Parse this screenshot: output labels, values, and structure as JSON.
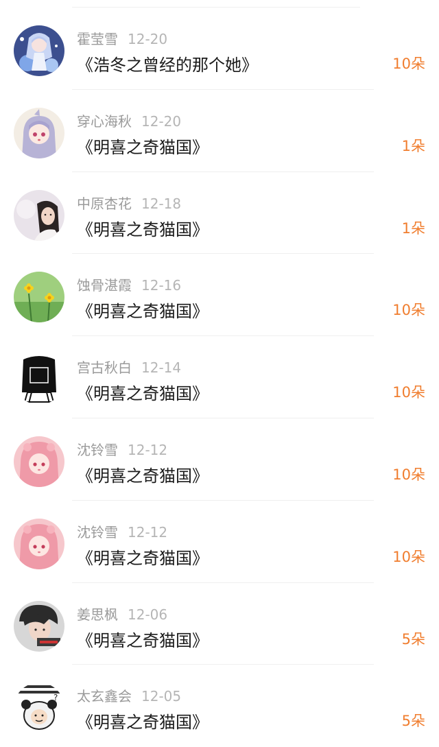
{
  "gift_records": [
    {
      "name": "霍莹雪",
      "date": "12-20",
      "title": "《浩冬之曾经的那个她》",
      "count": "10朵",
      "avatar_icon": "anime-girl-blue-avatar"
    },
    {
      "name": "穿心海秋",
      "date": "12-20",
      "title": "《明喜之奇猫国》",
      "count": "1朵",
      "avatar_icon": "anime-girl-lilac-hair-avatar"
    },
    {
      "name": "中原杏花",
      "date": "12-18",
      "title": "《明喜之奇猫国》",
      "count": "1朵",
      "avatar_icon": "girl-photo-avatar"
    },
    {
      "name": "蚀骨湛霞",
      "date": "12-16",
      "title": "《明喜之奇猫国》",
      "count": "10朵",
      "avatar_icon": "yellow-flowers-avatar"
    },
    {
      "name": "宫古秋白",
      "date": "12-14",
      "title": "《明喜之奇猫国》",
      "count": "10朵",
      "avatar_icon": "black-silhouette-girl-avatar"
    },
    {
      "name": "沈铃雪",
      "date": "12-12",
      "title": "《明喜之奇猫国》",
      "count": "10朵",
      "avatar_icon": "anime-girl-pink-avatar"
    },
    {
      "name": "沈铃雪",
      "date": "12-12",
      "title": "《明喜之奇猫国》",
      "count": "10朵",
      "avatar_icon": "anime-girl-pink-avatar"
    },
    {
      "name": "姜思枫",
      "date": "12-06",
      "title": "《明喜之奇猫国》",
      "count": "5朵",
      "avatar_icon": "boy-photo-avatar"
    },
    {
      "name": "太玄鑫会",
      "date": "12-05",
      "title": "《明喜之奇猫国》",
      "count": "5朵",
      "avatar_icon": "panda-meme-avatar"
    }
  ],
  "colors": {
    "count_accent": "#f07d2e",
    "name_text": "#9a9a9a",
    "date_text": "#b5b5b5",
    "title_text": "#1a1a1a"
  }
}
